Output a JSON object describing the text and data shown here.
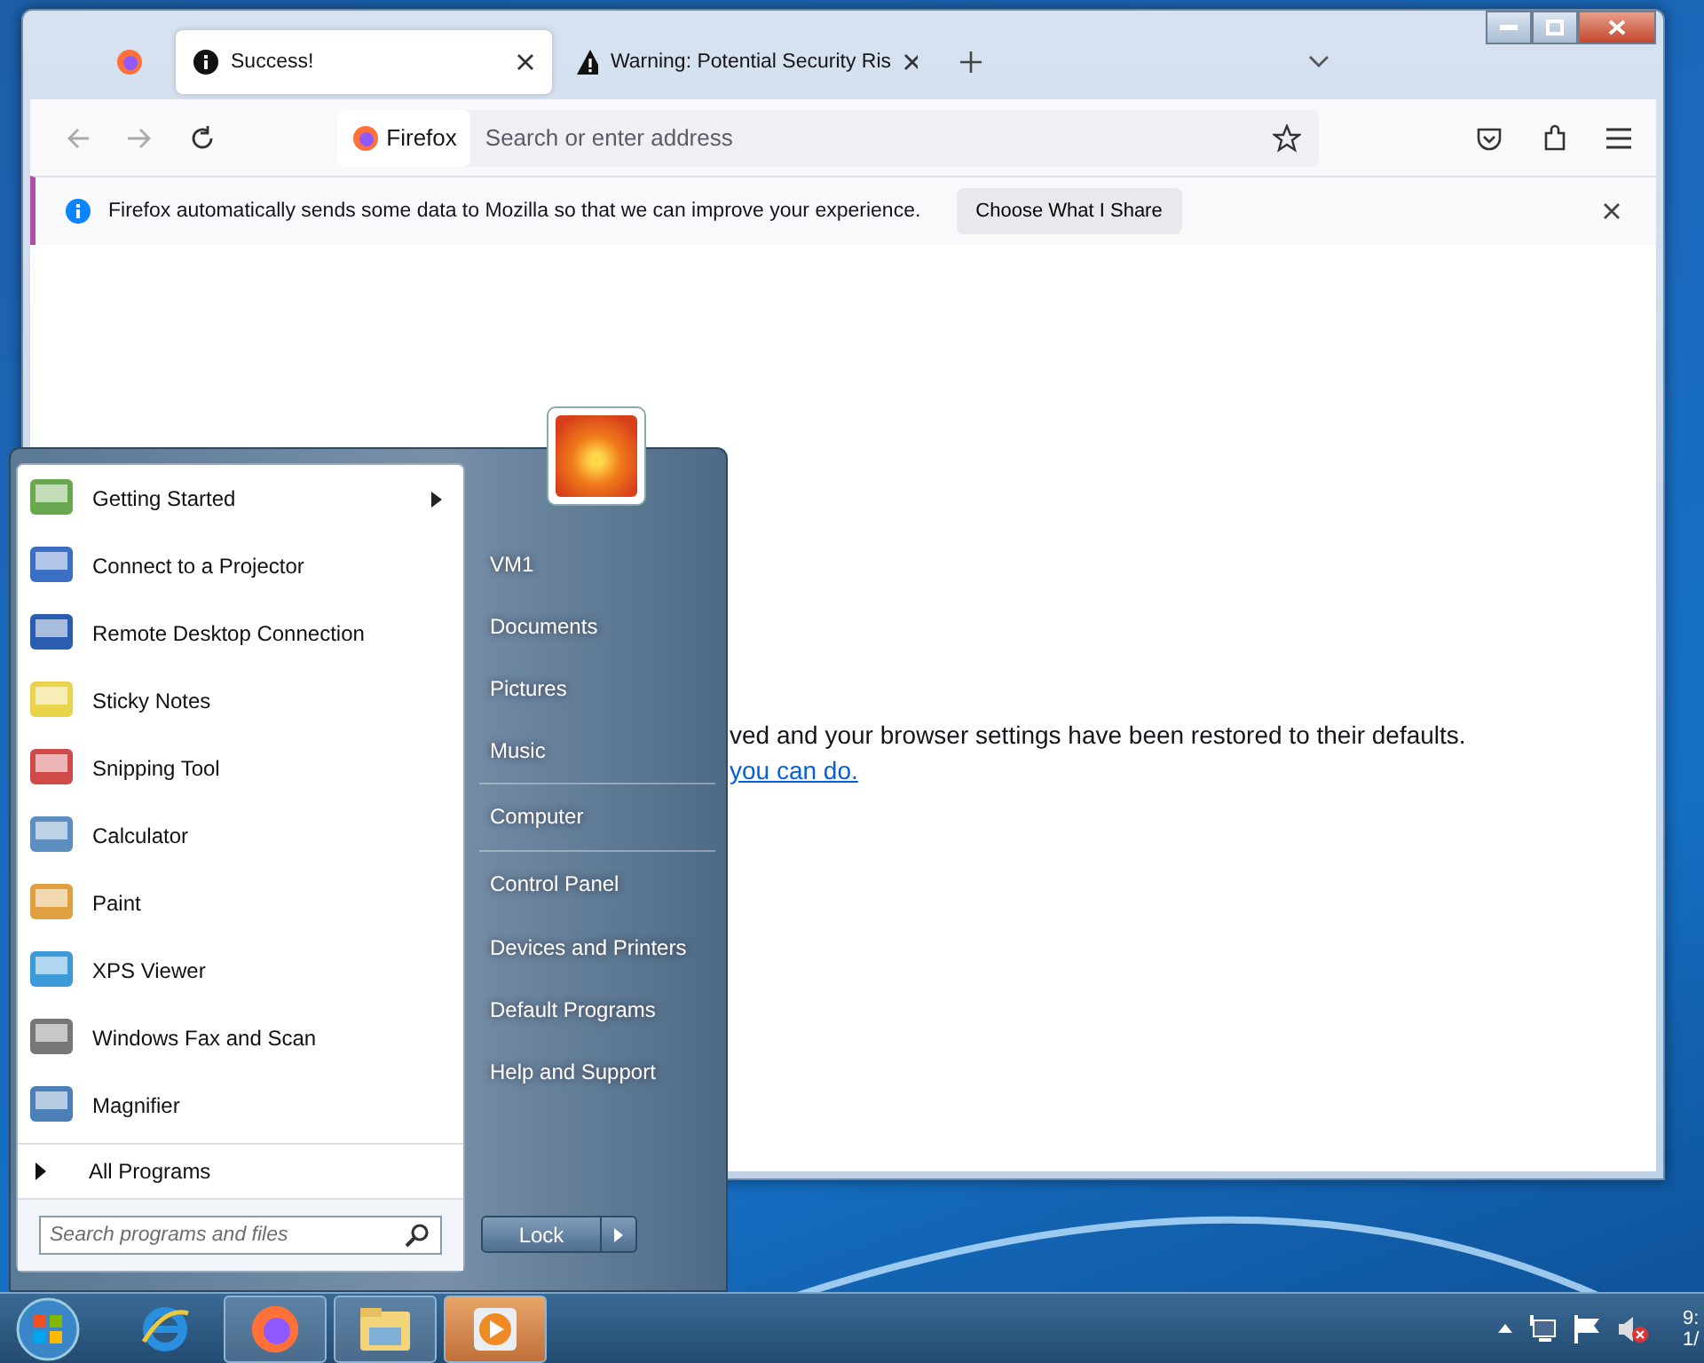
{
  "browser": {
    "tabs": [
      {
        "title": "Success!",
        "selected": true,
        "kind": "info"
      },
      {
        "title": "Warning: Potential Security Ris",
        "selected": false,
        "kind": "warning"
      }
    ],
    "identity": "Firefox",
    "address_placeholder": "Search or enter address",
    "notification": {
      "message": "Firefox automatically sends some data to Mozilla so that we can improve your experience.",
      "button": "Choose What I Share"
    },
    "page": {
      "text": "ved and your browser settings have been restored to their defaults.",
      "link": "you can do."
    }
  },
  "start_menu": {
    "programs": [
      {
        "label": "Getting Started",
        "submenu": true
      },
      {
        "label": "Connect to a Projector",
        "submenu": false
      },
      {
        "label": "Remote Desktop Connection",
        "submenu": false
      },
      {
        "label": "Sticky Notes",
        "submenu": false
      },
      {
        "label": "Snipping Tool",
        "submenu": false
      },
      {
        "label": "Calculator",
        "submenu": false
      },
      {
        "label": "Paint",
        "submenu": false
      },
      {
        "label": "XPS Viewer",
        "submenu": false
      },
      {
        "label": "Windows Fax and Scan",
        "submenu": false
      },
      {
        "label": "Magnifier",
        "submenu": false
      }
    ],
    "all_programs": "All Programs",
    "search_placeholder": "Search programs and files",
    "places": [
      {
        "label": "VM1",
        "divider_above": false
      },
      {
        "label": "Documents",
        "divider_above": false
      },
      {
        "label": "Pictures",
        "divider_above": false
      },
      {
        "label": "Music",
        "divider_above": false
      },
      {
        "label": "Computer",
        "divider_above": true
      },
      {
        "label": "Control Panel",
        "divider_above": true
      },
      {
        "label": "Devices and Printers",
        "divider_above": false
      },
      {
        "label": "Default Programs",
        "divider_above": false
      },
      {
        "label": "Help and Support",
        "divider_above": false
      }
    ],
    "shutdown_button": "Lock"
  },
  "taskbar": {
    "apps": [
      {
        "kind": "ie",
        "running": false,
        "highlighted": false
      },
      {
        "kind": "firefox",
        "running": true,
        "highlighted": false
      },
      {
        "kind": "explorer",
        "running": true,
        "highlighted": false
      },
      {
        "kind": "media",
        "running": true,
        "highlighted": true
      }
    ],
    "clock": [
      "9:",
      "1/"
    ]
  }
}
